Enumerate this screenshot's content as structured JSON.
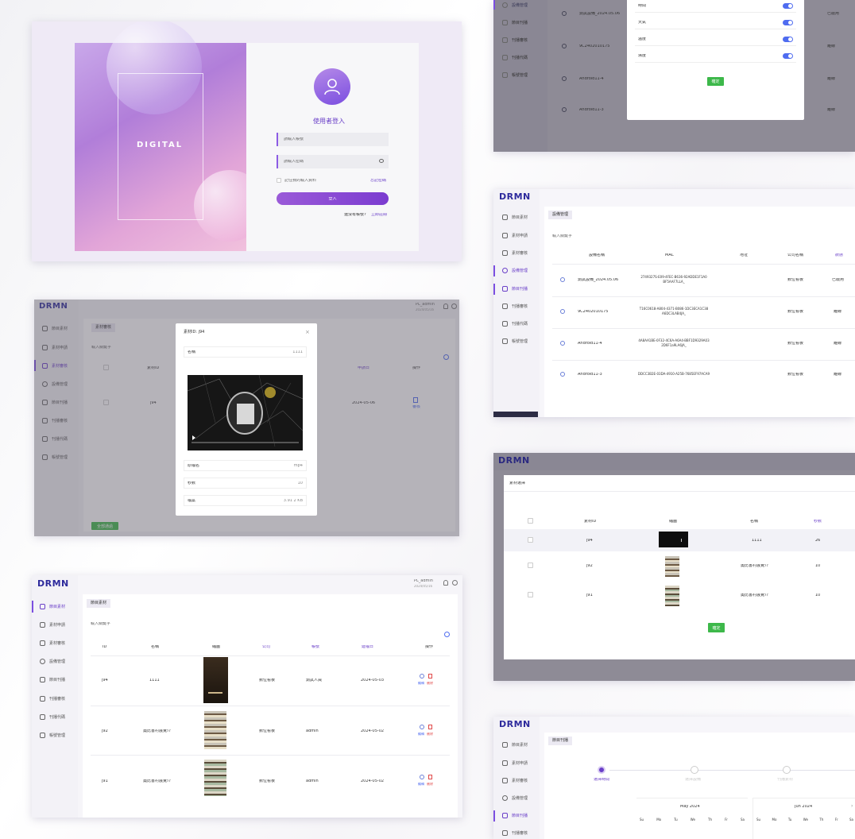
{
  "login": {
    "cover_text": "DIGITAL",
    "title": "使用者登入",
    "account_placeholder": "請輸入帳號",
    "password_placeholder": "請輸入密碼",
    "remember_label": "記住我的輸入資料",
    "forgot_label": "忘記密碼",
    "login_button": "登入",
    "no_account": "還沒有帳號?",
    "register": "立即註冊"
  },
  "brand": {
    "logo": "DRMN"
  },
  "user": {
    "name": "PL_admin",
    "date": "2024/05/16"
  },
  "sidebar": {
    "items": [
      {
        "label": "節目素材",
        "icon": "document-icon"
      },
      {
        "label": "素材申請",
        "icon": "calendar-icon"
      },
      {
        "label": "素材審核",
        "icon": "calendar-icon"
      },
      {
        "label": "設備管理",
        "icon": "location-icon"
      },
      {
        "label": "節目刊播",
        "icon": "video-icon"
      },
      {
        "label": "刊播審核",
        "icon": "calendar-icon"
      },
      {
        "label": "刊播代碼",
        "icon": "cursor-icon"
      },
      {
        "label": "帳號管理",
        "icon": "calendar-icon"
      }
    ]
  },
  "material_review": {
    "tab": "素材審核",
    "search_placeholder": "輸入關鍵字",
    "dialog_title": "素材ID: j94",
    "field_name_label": "名稱",
    "field_name_value": "1111",
    "file_name_label": "原檔名",
    "file_name_value": "mp4",
    "seconds_label": "秒數",
    "seconds_value": "10",
    "size_label": "檔案",
    "size_value": "3.91 2 KB",
    "row_id": "j94",
    "row_date": "2024-05-06",
    "button": "全部通過",
    "col_id": "素材ID",
    "col_date": "申請日",
    "col_action": "操作",
    "action_label": "審核"
  },
  "program_material": {
    "tab": "節目素材",
    "search_placeholder": "輸入關鍵字",
    "columns": [
      "ID",
      "名稱",
      "縮圖",
      "公司",
      "帳號",
      "建檔日",
      "操作"
    ],
    "rows": [
      {
        "id": "j94",
        "name": "1111",
        "company": "數位看板",
        "account": "測試人員",
        "date": "2024-05-03"
      },
      {
        "id": "j92",
        "name": "奧比書村展覽介",
        "company": "數位看板",
        "account": "admin",
        "date": "2024-05-02"
      },
      {
        "id": "j91",
        "name": "奧比書村展覽介",
        "company": "數位看板",
        "account": "admin",
        "date": "2024-05-02"
      }
    ],
    "edit": "編輯",
    "delete": "刪除"
  },
  "settings_dialog": {
    "rows": [
      "時間",
      "天氣",
      "溫度",
      "濕度"
    ],
    "confirm": "確定"
  },
  "device_mgmt": {
    "tab": "設備管理",
    "search_placeholder": "輸入關鍵字",
    "columns": [
      "設備名稱",
      "MAC",
      "地址",
      "公司名稱",
      "狀態"
    ],
    "rows": [
      {
        "name": "測試設備_2024.05.06",
        "mac": "2749327S-E09-4FEC-B636-92ADDE1F1A0 BF5AAF7LLA_",
        "company": "數位看板",
        "status": "已啟用"
      },
      {
        "name": "9C2402010175",
        "mac": "T16C0618-A804-4371-B086-1DC3ECA1C38 A6DC3LAB4JA_",
        "company": "數位看板",
        "status": "離線"
      },
      {
        "name": "Android11-4",
        "mac": "4A8AA1BE-0F32-4C6A-A6A4-BBF1D9329A03 2D6F1a9LA6JA_",
        "company": "數位看板",
        "status": "離線"
      },
      {
        "name": "Android11-3",
        "mac": "DDCC3B2E-03DA-4910-A25B-7685EF97ACA9",
        "company": "數位看板",
        "status": "離線"
      }
    ]
  },
  "select_material": {
    "tab": "素材選擇",
    "columns": [
      "素材ID",
      "縮圖",
      "名稱",
      "秒數"
    ],
    "rows": [
      {
        "id": "j94",
        "name": "1111",
        "seconds": "26"
      },
      {
        "id": "j92",
        "name": "奧比書村展覽介",
        "seconds": "10"
      },
      {
        "id": "j91",
        "name": "奧比書村展覽介",
        "seconds": "10"
      }
    ],
    "confirm": "確定"
  },
  "schedule": {
    "tab": "節目刊播",
    "steps": [
      "選擇時間",
      "選擇設備",
      "刊播素材"
    ],
    "month1": "May 2024",
    "month2": "Jun 2024",
    "weekdays": [
      "Su",
      "Mo",
      "Tu",
      "We",
      "Th",
      "Fr",
      "Sa"
    ]
  }
}
